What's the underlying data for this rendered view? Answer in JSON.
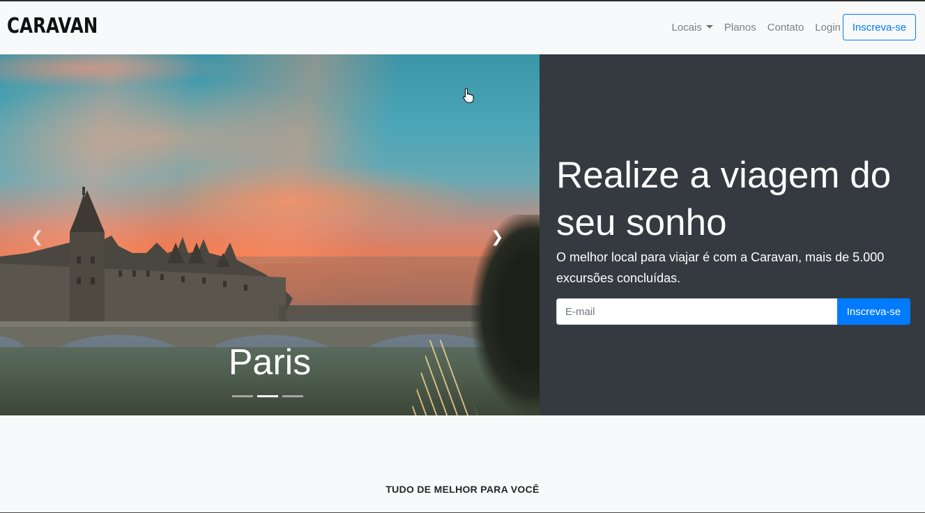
{
  "navbar": {
    "brand": "CARAVAN",
    "links": [
      {
        "label": "Locais",
        "dropdown": true
      },
      {
        "label": "Planos"
      },
      {
        "label": "Contato"
      },
      {
        "label": "Login"
      }
    ],
    "cta_label": "Inscreva-se"
  },
  "carousel": {
    "caption": "Paris",
    "indicator_count": 3,
    "active_indicator": 2,
    "prev_icon": "chevron-left-icon",
    "next_icon": "chevron-right-icon"
  },
  "signup": {
    "heading": "Realize a viagem do seu sonho",
    "subtext": "O melhor local para viajar é com a Caravan, mais de 5.000 excursões concluídas.",
    "email_placeholder": "E-mail",
    "email_value": "",
    "button_label": "Inscreva-se"
  },
  "section": {
    "title": "TUDO DE MELHOR PARA VOCÊ"
  },
  "colors": {
    "primary": "#007bff",
    "dark_panel": "#343a40",
    "navbar_bg": "#f8f9fa"
  }
}
